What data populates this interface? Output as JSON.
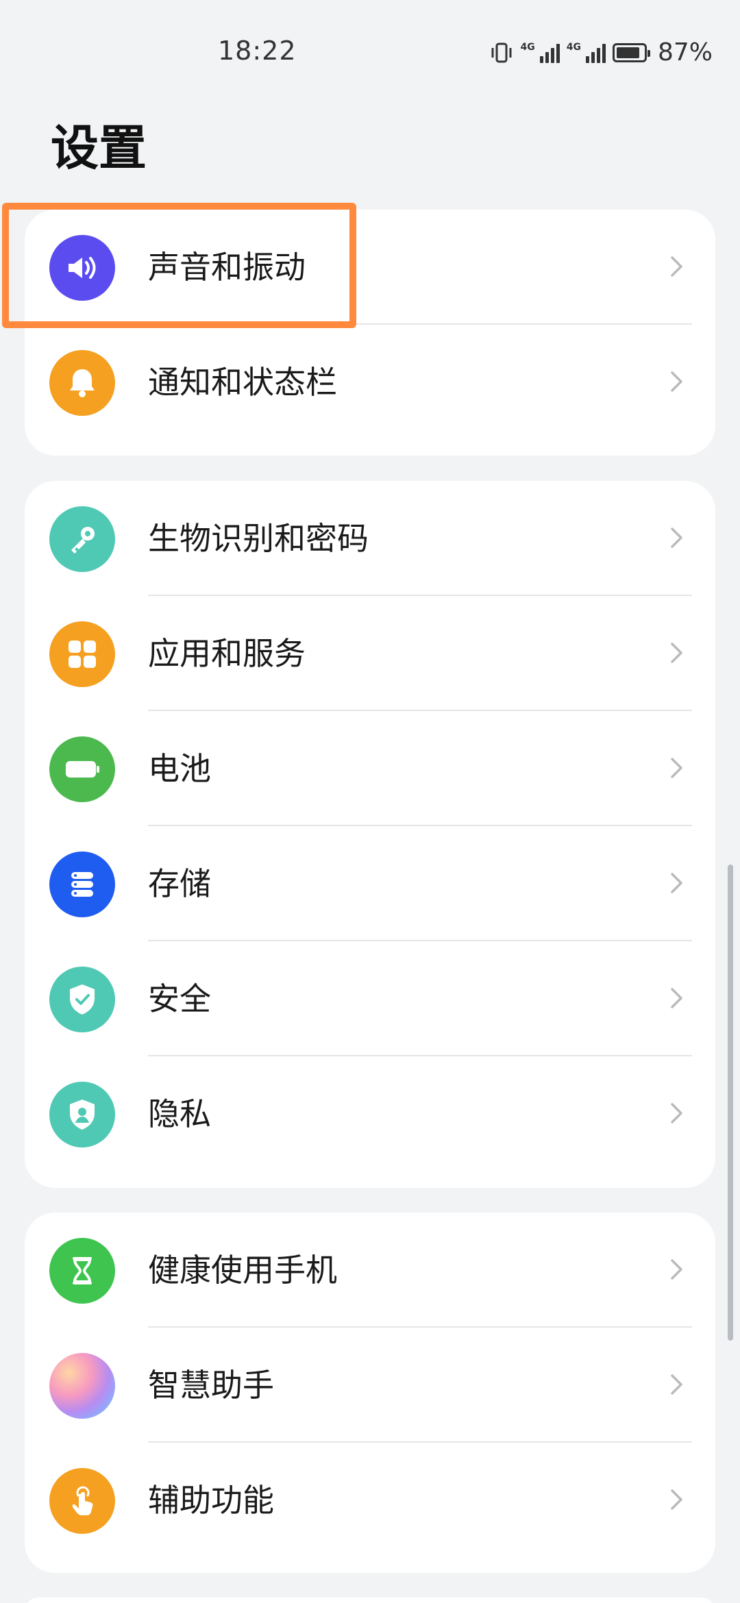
{
  "status_bar": {
    "time": "18:22",
    "network_1": "4G",
    "network_2": "4G",
    "battery_percent": "87%",
    "battery_level": 0.87
  },
  "page": {
    "title": "设置"
  },
  "groups": [
    {
      "items": [
        {
          "label": "声音和振动",
          "icon": "speaker-icon",
          "color": "#5b4cf0"
        },
        {
          "label": "通知和状态栏",
          "icon": "bell-icon",
          "color": "#f5a020"
        }
      ]
    },
    {
      "items": [
        {
          "label": "生物识别和密码",
          "icon": "key-icon",
          "color": "#4fc9b4"
        },
        {
          "label": "应用和服务",
          "icon": "apps-grid-icon",
          "color": "#f5a020"
        },
        {
          "label": "电池",
          "icon": "battery-icon",
          "color": "#4cb94f"
        },
        {
          "label": "存储",
          "icon": "storage-icon",
          "color": "#1f5cf0"
        },
        {
          "label": "安全",
          "icon": "shield-check-icon",
          "color": "#4fc9b4"
        },
        {
          "label": "隐私",
          "icon": "privacy-shield-icon",
          "color": "#4fc9b4"
        }
      ]
    },
    {
      "items": [
        {
          "label": "健康使用手机",
          "icon": "hourglass-icon",
          "color": "#3ec44f"
        },
        {
          "label": "智慧助手",
          "icon": "assistant-orb-icon",
          "color": "#d88be6"
        },
        {
          "label": "辅助功能",
          "icon": "hand-tap-icon",
          "color": "#f5a020"
        }
      ]
    }
  ],
  "highlight_color": "#ff8a3d"
}
